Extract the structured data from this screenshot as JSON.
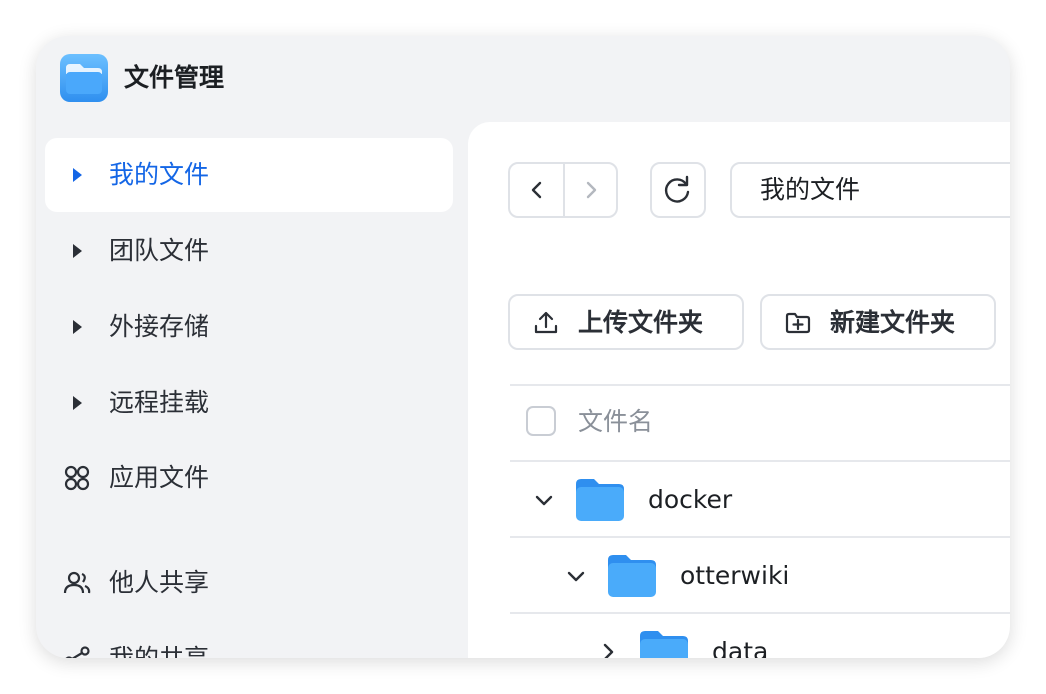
{
  "app": {
    "title": "文件管理",
    "icon": "folder-app-icon"
  },
  "sidebar": {
    "items": [
      {
        "label": "我的文件",
        "icon": "caret-right-icon",
        "active": true
      },
      {
        "label": "团队文件",
        "icon": "caret-right-icon",
        "active": false
      },
      {
        "label": "外接存储",
        "icon": "caret-right-icon",
        "active": false
      },
      {
        "label": "远程挂载",
        "icon": "caret-right-icon",
        "active": false
      },
      {
        "label": "应用文件",
        "icon": "apps-grid-icon",
        "active": false
      },
      {
        "label": "他人共享",
        "icon": "users-icon",
        "active": false
      },
      {
        "label": "我的共享",
        "icon": "share-icon",
        "active": false
      }
    ]
  },
  "toolbar": {
    "path": "我的文件",
    "upload_folder_label": "上传文件夹",
    "new_folder_label": "新建文件夹"
  },
  "file_list": {
    "header": {
      "name_column": "文件名"
    },
    "rows": [
      {
        "name": "docker",
        "expanded": true,
        "depth": 0
      },
      {
        "name": "otterwiki",
        "expanded": true,
        "depth": 1
      },
      {
        "name": "data",
        "expanded": false,
        "depth": 2
      }
    ]
  },
  "colors": {
    "accent": "#1466e6",
    "sidebar_bg": "#f2f3f5",
    "folder_blue": "#3a9bf5"
  }
}
